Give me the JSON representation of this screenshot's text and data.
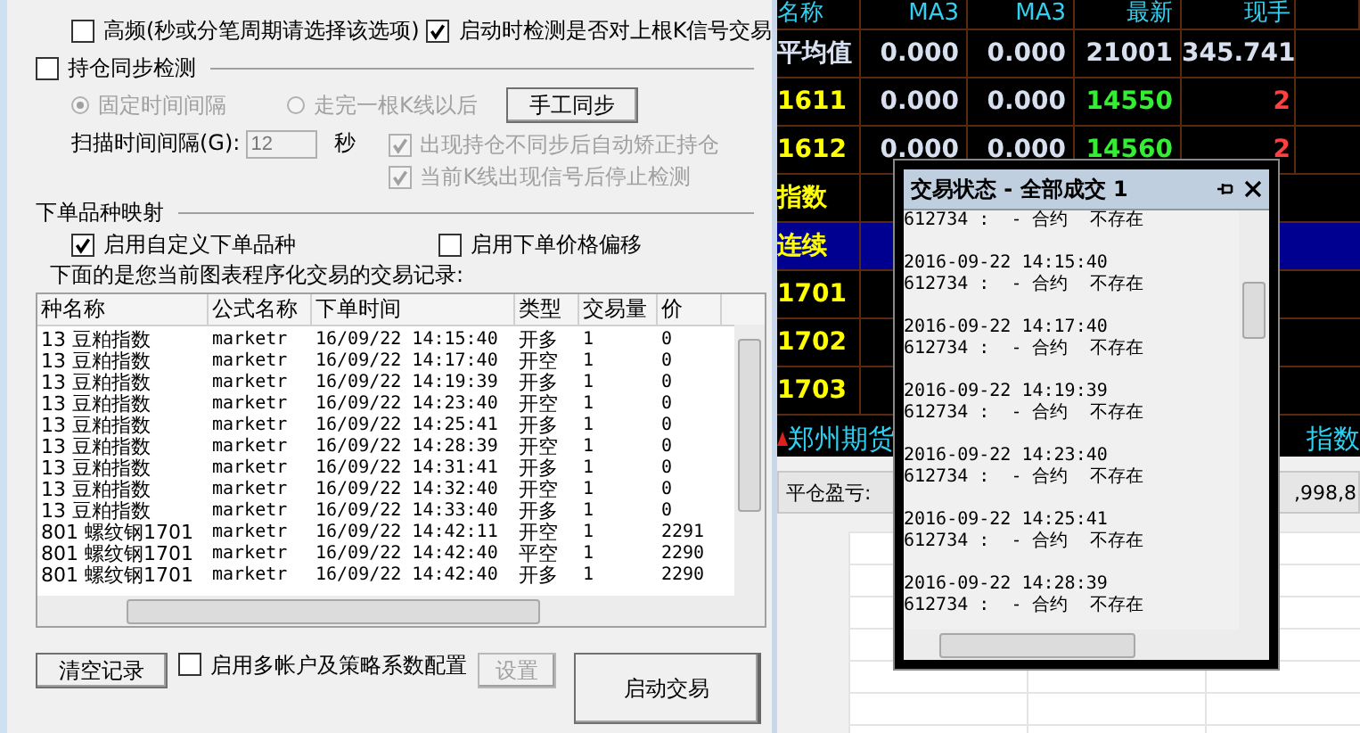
{
  "options": {
    "high_frequency": {
      "label": "高频(秒或分笔周期请选择该选项)",
      "checked": false
    },
    "check_last_bar": {
      "label": "启动时检测是否对上根K信号交易",
      "checked": true
    }
  },
  "position_sync": {
    "label": "持仓同步检测",
    "checked": false,
    "modes": [
      {
        "label": "固定时间间隔",
        "selected": true
      },
      {
        "label": "走完一根K线以后",
        "selected": false
      }
    ],
    "manual_button": "手工同步",
    "interval_label": "扫描时间间隔(G):",
    "interval_value": "12",
    "interval_unit": "秒",
    "checks": [
      {
        "label": "出现持仓不同步后自动矫正持仓",
        "checked": true
      },
      {
        "label": "当前K线出现信号后停止检测",
        "checked": true
      }
    ]
  },
  "mapping": {
    "title": "下单品种映射",
    "checks": [
      {
        "label": "启用自定义下单品种",
        "checked": true
      },
      {
        "label": "启用下单价格偏移",
        "checked": false
      }
    ],
    "records_caption": "下面的是您当前图表程序化交易的交易记录:"
  },
  "records": {
    "columns": [
      "种名称",
      "公式名称",
      "下单时间",
      "类型",
      "交易量",
      "价"
    ],
    "rows": [
      [
        "13  豆粕指数",
        "marketr",
        "16/09/22  14:15:40",
        "开多",
        "1",
        "0"
      ],
      [
        "13  豆粕指数",
        "marketr",
        "16/09/22  14:17:40",
        "开空",
        "1",
        "0"
      ],
      [
        "13  豆粕指数",
        "marketr",
        "16/09/22  14:19:39",
        "开多",
        "1",
        "0"
      ],
      [
        "13  豆粕指数",
        "marketr",
        "16/09/22  14:23:40",
        "开空",
        "1",
        "0"
      ],
      [
        "13  豆粕指数",
        "marketr",
        "16/09/22  14:25:41",
        "开多",
        "1",
        "0"
      ],
      [
        "13  豆粕指数",
        "marketr",
        "16/09/22  14:28:39",
        "开空",
        "1",
        "0"
      ],
      [
        "13  豆粕指数",
        "marketr",
        "16/09/22  14:31:41",
        "开多",
        "1",
        "0"
      ],
      [
        "13  豆粕指数",
        "marketr",
        "16/09/22  14:32:40",
        "开空",
        "1",
        "0"
      ],
      [
        "13  豆粕指数",
        "marketr",
        "16/09/22  14:33:40",
        "开多",
        "1",
        "0"
      ],
      [
        "801  螺纹钢1701",
        "marketr",
        "16/09/22  14:42:11",
        "开空",
        "1",
        "2291"
      ],
      [
        "801  螺纹钢1701",
        "marketr",
        "16/09/22  14:42:40",
        "平空",
        "1",
        "2290"
      ],
      [
        "801  螺纹钢1701",
        "marketr",
        "16/09/22  14:42:40",
        "开多",
        "1",
        "2290"
      ]
    ]
  },
  "footer": {
    "clear_button": "清空记录",
    "multi_account": {
      "label": "启用多帐户及策略系数配置",
      "checked": false
    },
    "settings_button": {
      "label": "设置",
      "disabled": true
    },
    "start_button": "启动交易"
  },
  "quotes": {
    "columns": [
      "名称",
      "MA3",
      "MA3",
      "最新",
      "现手"
    ],
    "rows": [
      {
        "selected": false,
        "cells": [
          {
            "text": "平均值",
            "kind": "plain"
          },
          {
            "text": "0.000",
            "kind": "plain"
          },
          {
            "text": "0.000",
            "kind": "plain"
          },
          {
            "text": "21001",
            "kind": "plain"
          },
          {
            "text": "345.741",
            "kind": "plain"
          }
        ]
      },
      {
        "selected": false,
        "cells": [
          {
            "text": "1611",
            "kind": "name"
          },
          {
            "text": "0.000",
            "kind": "plain"
          },
          {
            "text": "0.000",
            "kind": "plain"
          },
          {
            "text": "14550",
            "kind": "down"
          },
          {
            "text": "2",
            "kind": "up"
          }
        ]
      },
      {
        "selected": false,
        "cells": [
          {
            "text": "1612",
            "kind": "name"
          },
          {
            "text": "0.000",
            "kind": "plain"
          },
          {
            "text": "0.000",
            "kind": "plain"
          },
          {
            "text": "14560",
            "kind": "down"
          },
          {
            "text": "2",
            "kind": "up"
          }
        ]
      },
      {
        "selected": false,
        "cells": [
          {
            "text": "指数",
            "kind": "name"
          }
        ]
      },
      {
        "selected": true,
        "cells": [
          {
            "text": "连续",
            "kind": "name"
          }
        ]
      },
      {
        "selected": false,
        "cells": [
          {
            "text": "1701",
            "kind": "name"
          }
        ]
      },
      {
        "selected": false,
        "cells": [
          {
            "text": "1702",
            "kind": "name"
          }
        ]
      },
      {
        "selected": false,
        "cells": [
          {
            "text": "1703",
            "kind": "name"
          }
        ]
      }
    ],
    "tabs": [
      "郑州期货",
      "指数"
    ]
  },
  "account": {
    "label": "平仓盈亏:",
    "value": ",998,8"
  },
  "popup": {
    "title": "交易状态 - 全部成交 1",
    "entries": [
      {
        "message": "612734 :  - 合约  不存在"
      },
      {
        "time": "2016-09-22 14:15:40",
        "message": "612734 :  - 合约  不存在"
      },
      {
        "time": "2016-09-22 14:17:40",
        "message": "612734 :  - 合约  不存在"
      },
      {
        "time": "2016-09-22 14:19:39",
        "message": "612734 :  - 合约  不存在"
      },
      {
        "time": "2016-09-22 14:23:40",
        "message": "612734 :  - 合约  不存在"
      },
      {
        "time": "2016-09-22 14:25:41",
        "message": "612734 :  - 合约  不存在"
      },
      {
        "time": "2016-09-22 14:28:39",
        "message": "612734 :  - 合约  不存在"
      }
    ]
  }
}
